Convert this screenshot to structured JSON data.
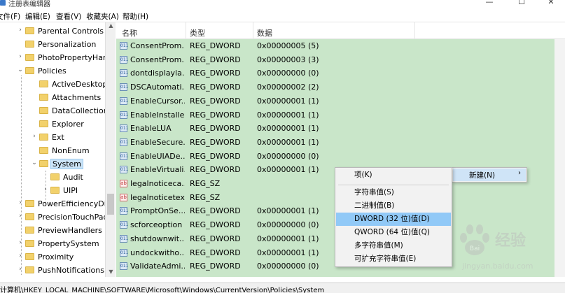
{
  "window": {
    "title": "注册表编辑器",
    "min_glyph": "—",
    "max_glyph": "☐",
    "close_glyph": "✕"
  },
  "menubar": [
    "文件(F)",
    "编辑(E)",
    "查看(V)",
    "收藏夹(A)",
    "帮助(H)"
  ],
  "tree": {
    "items": [
      {
        "label": "Parental Controls",
        "level": 1,
        "arrow": "›"
      },
      {
        "label": "Personalization",
        "level": 1,
        "arrow": ""
      },
      {
        "label": "PhotoPropertyHan",
        "level": 1,
        "arrow": "›"
      },
      {
        "label": "Policies",
        "level": 1,
        "arrow": "⌄"
      },
      {
        "label": "ActiveDesktop",
        "level": 2,
        "arrow": ""
      },
      {
        "label": "Attachments",
        "level": 2,
        "arrow": ""
      },
      {
        "label": "DataCollection",
        "level": 2,
        "arrow": ""
      },
      {
        "label": "Explorer",
        "level": 2,
        "arrow": ""
      },
      {
        "label": "Ext",
        "level": 2,
        "arrow": "›"
      },
      {
        "label": "NonEnum",
        "level": 2,
        "arrow": ""
      },
      {
        "label": "System",
        "level": 2,
        "arrow": "⌄"
      },
      {
        "label": "Audit",
        "level": 3,
        "arrow": ""
      },
      {
        "label": "UIPI",
        "level": 3,
        "arrow": "›"
      },
      {
        "label": "PowerEfficiencyDia",
        "level": 1,
        "arrow": "›"
      },
      {
        "label": "PrecisionTouchPad",
        "level": 1,
        "arrow": "›"
      },
      {
        "label": "PreviewHandlers",
        "level": 1,
        "arrow": ""
      },
      {
        "label": "PropertySystem",
        "level": 1,
        "arrow": "›"
      },
      {
        "label": "Proximity",
        "level": 1,
        "arrow": "›"
      },
      {
        "label": "PushNotifications",
        "level": 1,
        "arrow": "›"
      }
    ],
    "selected": "System"
  },
  "list": {
    "headers": {
      "name": "名称",
      "type": "类型",
      "data": "数据"
    },
    "rows": [
      {
        "name": "ConsentProm...",
        "type": "REG_DWORD",
        "data": "0x00000005 (5)",
        "icon": "dword"
      },
      {
        "name": "ConsentProm...",
        "type": "REG_DWORD",
        "data": "0x00000003 (3)",
        "icon": "dword"
      },
      {
        "name": "dontdisplayla...",
        "type": "REG_DWORD",
        "data": "0x00000000 (0)",
        "icon": "dword"
      },
      {
        "name": "DSCAutomati...",
        "type": "REG_DWORD",
        "data": "0x00000002 (2)",
        "icon": "dword"
      },
      {
        "name": "EnableCursor...",
        "type": "REG_DWORD",
        "data": "0x00000001 (1)",
        "icon": "dword"
      },
      {
        "name": "EnableInstalle...",
        "type": "REG_DWORD",
        "data": "0x00000001 (1)",
        "icon": "dword"
      },
      {
        "name": "EnableLUA",
        "type": "REG_DWORD",
        "data": "0x00000001 (1)",
        "icon": "dword"
      },
      {
        "name": "EnableSecure...",
        "type": "REG_DWORD",
        "data": "0x00000001 (1)",
        "icon": "dword"
      },
      {
        "name": "EnableUIADe...",
        "type": "REG_DWORD",
        "data": "0x00000000 (0)",
        "icon": "dword"
      },
      {
        "name": "EnableVirtuali...",
        "type": "REG_DWORD",
        "data": "0x00000001 (1)",
        "icon": "dword"
      },
      {
        "name": "legalnoticeca...",
        "type": "REG_SZ",
        "data": "",
        "icon": "sz"
      },
      {
        "name": "legalnoticetext",
        "type": "REG_SZ",
        "data": "",
        "icon": "sz"
      },
      {
        "name": "PromptOnSe...",
        "type": "REG_DWORD",
        "data": "0x00000001 (1)",
        "icon": "dword"
      },
      {
        "name": "scforceoption",
        "type": "REG_DWORD",
        "data": "0x00000000 (0)",
        "icon": "dword"
      },
      {
        "name": "shutdownwit...",
        "type": "REG_DWORD",
        "data": "0x00000001 (1)",
        "icon": "dword"
      },
      {
        "name": "undockwitho...",
        "type": "REG_DWORD",
        "data": "0x00000001 (1)",
        "icon": "dword"
      },
      {
        "name": "ValidateAdmi...",
        "type": "REG_DWORD",
        "data": "0x00000000 (0)",
        "icon": "dword"
      }
    ]
  },
  "context_menu_parent": {
    "label": "新建(N)",
    "chevron": "›"
  },
  "context_menu": {
    "items": [
      "项(K)",
      "字符串值(S)",
      "二进制值(B)",
      "DWORD (32 位)值(D)",
      "QWORD (64 位)值(Q)",
      "多字符串值(M)",
      "可扩充字符串值(E)"
    ],
    "highlighted": "DWORD (32 位)值(D)"
  },
  "statusbar": {
    "path": "计算机\\HKEY_LOCAL_MACHINE\\SOFTWARE\\Microsoft\\Windows\\CurrentVersion\\Policies\\System"
  },
  "icons": {
    "dword": "011",
    "sz": "ab"
  },
  "watermark": {
    "brand": "经验",
    "url": "jingyan.baidu.com"
  },
  "colors": {
    "list_bg": "#c9e6c9",
    "highlight": "#91c9f7",
    "tree_selected": "#cce4f7"
  }
}
